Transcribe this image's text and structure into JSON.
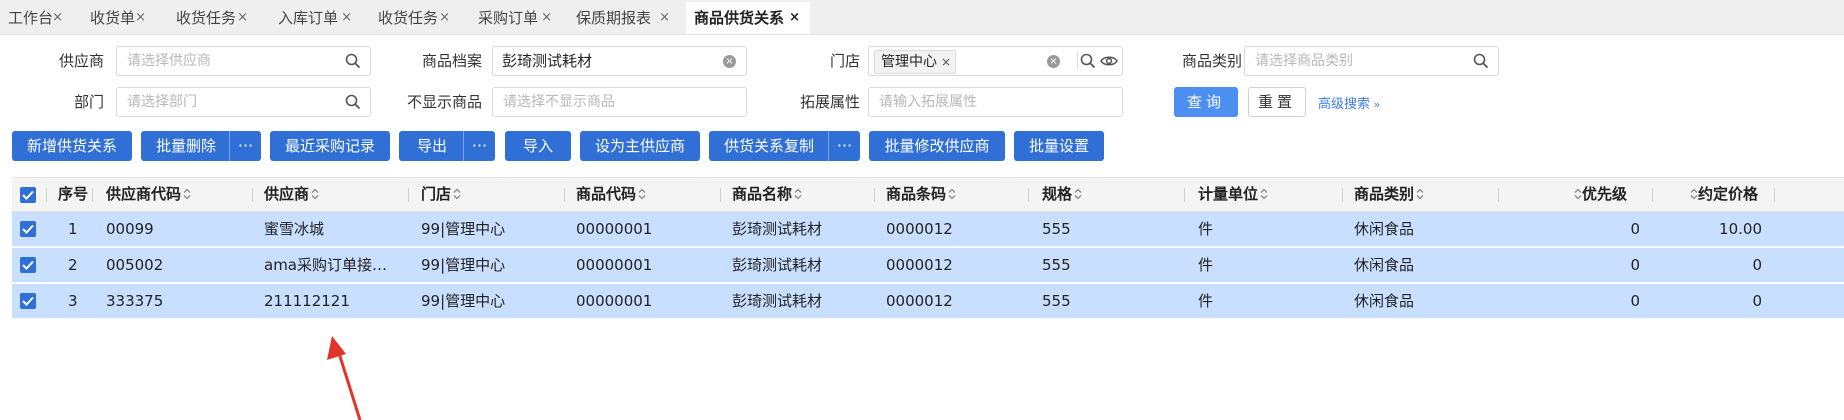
{
  "tabs": [
    {
      "label": "工作台",
      "close": "×"
    },
    {
      "label": "收货单",
      "close": "×"
    },
    {
      "label": "收货任务",
      "close": "×"
    },
    {
      "label": "入库订单",
      "close": "×"
    },
    {
      "label": "收货任务",
      "close": "×"
    },
    {
      "label": "采购订单",
      "close": "×"
    },
    {
      "label": "保质期报表",
      "close": "×"
    },
    {
      "label": "商品供货关系",
      "close": "×",
      "active": true
    }
  ],
  "filters": {
    "supplier": {
      "label": "供应商",
      "placeholder": "请选择供应商"
    },
    "product_file": {
      "label": "商品档案",
      "value": "彭琦测试耗材"
    },
    "store": {
      "label": "门店",
      "chip": "管理中心",
      "chip_close": "×"
    },
    "category": {
      "label": "商品类别",
      "placeholder": "请选择商品类别"
    },
    "department": {
      "label": "部门",
      "placeholder": "请选择部门"
    },
    "hidden_products": {
      "label": "不显示商品",
      "placeholder": "请选择不显示商品"
    },
    "ext_attr": {
      "label": "拓展属性",
      "placeholder": "请输入拓展属性"
    }
  },
  "search": {
    "query": "查询",
    "reset": "重置",
    "advanced": "高级搜索"
  },
  "actions": {
    "add": "新增供货关系",
    "batch_delete": "批量删除",
    "recent_purchase": "最近采购记录",
    "export": "导出",
    "import": "导入",
    "set_main": "设为主供应商",
    "copy_relation": "供货关系复制",
    "batch_edit_supplier": "批量修改供应商",
    "batch_settings": "批量设置",
    "more": "···"
  },
  "table": {
    "headers": [
      "序号",
      "供应商代码",
      "供应商",
      "门店",
      "商品代码",
      "商品名称",
      "商品条码",
      "规格",
      "计量单位",
      "商品类别",
      "优先级",
      "约定价格"
    ],
    "rows": [
      [
        "1",
        "00099",
        "蜜雪冰城",
        "99|管理中心",
        "00000001",
        "彭琦测试耗材",
        "0000012",
        "555",
        "件",
        "休闲食品",
        "0",
        "10.00"
      ],
      [
        "2",
        "005002",
        "ama采购订单接…",
        "99|管理中心",
        "00000001",
        "彭琦测试耗材",
        "0000012",
        "555",
        "件",
        "休闲食品",
        "0",
        "0"
      ],
      [
        "3",
        "333375",
        "211112121",
        "99|管理中心",
        "00000001",
        "彭琦测试耗材",
        "0000012",
        "555",
        "件",
        "休闲食品",
        "0",
        "0"
      ]
    ]
  },
  "colors": {
    "primary": "#2f6fd6",
    "query_button": "#4d8ff0",
    "row_selected": "#c8dfff",
    "annotation_arrow": "#e0352b"
  }
}
